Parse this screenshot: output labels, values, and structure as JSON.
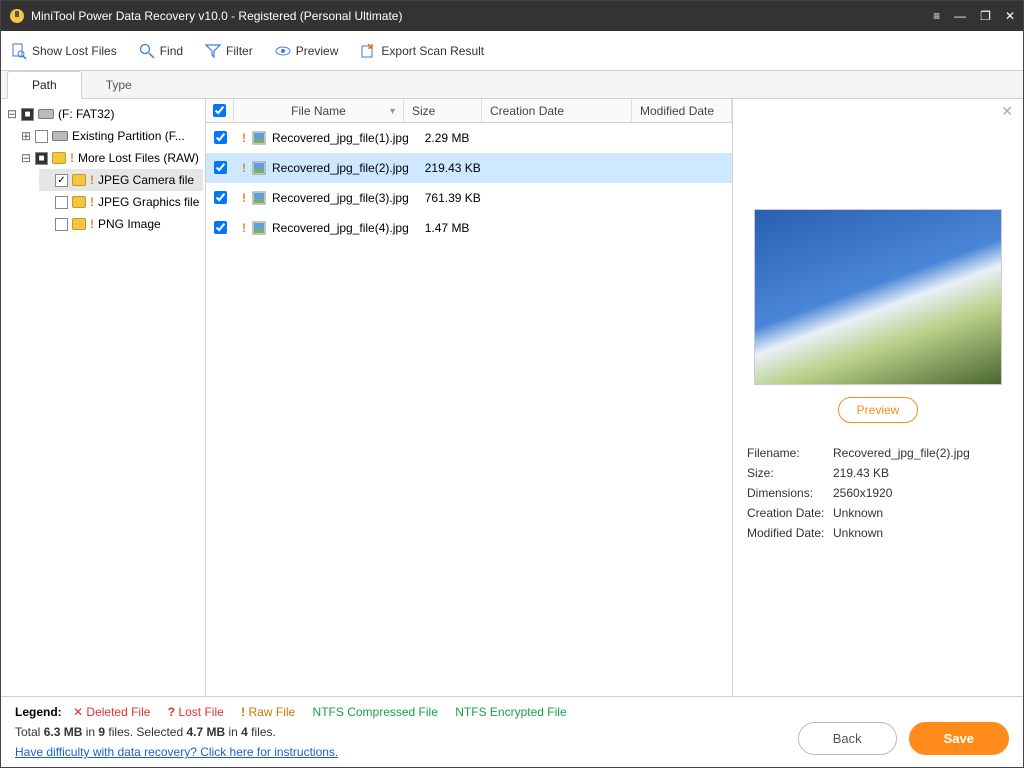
{
  "titlebar": {
    "title": "MiniTool Power Data Recovery v10.0 - Registered (Personal Ultimate)"
  },
  "toolbar": {
    "show_lost": "Show Lost Files",
    "find": "Find",
    "filter": "Filter",
    "preview": "Preview",
    "export": "Export Scan Result"
  },
  "tabs": {
    "path": "Path",
    "type": "Type"
  },
  "tree": {
    "root": "(F: FAT32)",
    "existing": "Existing Partition (F...",
    "more_lost": "More Lost Files (RAW)",
    "jpeg_cam": "JPEG Camera file",
    "jpeg_gfx": "JPEG Graphics file",
    "png": "PNG Image"
  },
  "columns": {
    "name": "File Name",
    "size": "Size",
    "cdate": "Creation Date",
    "mdate": "Modified Date"
  },
  "files": [
    {
      "name": "Recovered_jpg_file(1).jpg",
      "size": "2.29 MB"
    },
    {
      "name": "Recovered_jpg_file(2).jpg",
      "size": "219.43 KB"
    },
    {
      "name": "Recovered_jpg_file(3).jpg",
      "size": "761.39 KB"
    },
    {
      "name": "Recovered_jpg_file(4).jpg",
      "size": "1.47 MB"
    }
  ],
  "preview": {
    "button": "Preview",
    "filename_k": "Filename:",
    "filename_v": "Recovered_jpg_file(2).jpg",
    "size_k": "Size:",
    "size_v": "219.43 KB",
    "dim_k": "Dimensions:",
    "dim_v": "2560x1920",
    "cdate_k": "Creation Date:",
    "cdate_v": "Unknown",
    "mdate_k": "Modified Date:",
    "mdate_v": "Unknown"
  },
  "legend": {
    "label": "Legend:",
    "deleted": "Deleted File",
    "lost": "Lost File",
    "raw": "Raw File",
    "compressed": "NTFS Compressed File",
    "encrypted": "NTFS Encrypted File"
  },
  "summary": {
    "total_pre": "Total ",
    "total_size": "6.3 MB",
    "in1": " in ",
    "total_files": "9",
    "files1": " files.  Selected ",
    "sel_size": "4.7 MB",
    "in2": " in ",
    "sel_files": "4",
    "files2": " files."
  },
  "help_link": "Have difficulty with data recovery? Click here for instructions.",
  "buttons": {
    "back": "Back",
    "save": "Save"
  }
}
